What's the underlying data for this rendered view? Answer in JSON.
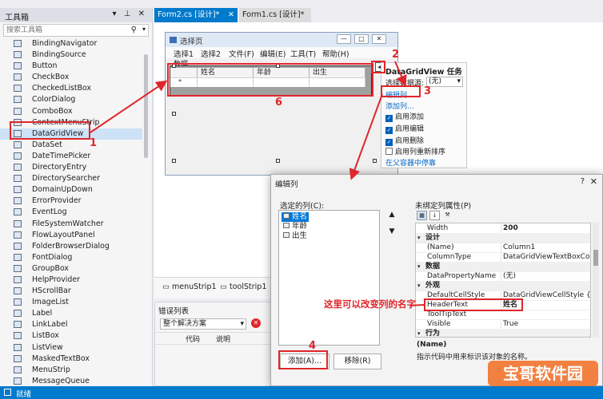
{
  "toolbox": {
    "title": "工具箱",
    "search_placeholder": "搜索工具箱",
    "items": [
      "BindingNavigator",
      "BindingSource",
      "Button",
      "CheckBox",
      "CheckedListBox",
      "ColorDialog",
      "ComboBox",
      "ContextMenuStrip",
      "DataGridView",
      "DataSet",
      "DateTimePicker",
      "DirectoryEntry",
      "DirectorySearcher",
      "DomainUpDown",
      "ErrorProvider",
      "EventLog",
      "FileSystemWatcher",
      "FlowLayoutPanel",
      "FolderBrowserDialog",
      "FontDialog",
      "GroupBox",
      "HelpProvider",
      "HScrollBar",
      "ImageList",
      "Label",
      "LinkLabel",
      "ListBox",
      "ListView",
      "MaskedTextBox",
      "MenuStrip",
      "MessageQueue"
    ],
    "selected": "DataGridView"
  },
  "tabs": [
    {
      "label": "Form2.cs [设计]*",
      "active": true
    },
    {
      "label": "Form1.cs [设计]*",
      "active": false
    }
  ],
  "form": {
    "title": "选择页",
    "menu": [
      "选择1",
      "选择2",
      "文件(F)",
      "编辑(E)",
      "工具(T)",
      "帮助(H)"
    ],
    "data_label": "数据",
    "grid_columns": [
      "姓名",
      "年龄",
      "出生"
    ],
    "new_row_marker": "*"
  },
  "tasks": {
    "title": "DataGridView 任务",
    "datasource_label": "选择数据源:",
    "datasource_value": "(无)",
    "edit_columns": "编辑列...",
    "add_column": "添加列...",
    "options": [
      {
        "label": "启用添加",
        "checked": true
      },
      {
        "label": "启用编辑",
        "checked": true
      },
      {
        "label": "启用删除",
        "checked": true
      },
      {
        "label": "启用列重新排序",
        "checked": false
      }
    ],
    "dock": "在父容器中停靠"
  },
  "strip": [
    "menuStrip1",
    "toolStrip1"
  ],
  "errors": {
    "title": "错误列表",
    "scope": "整个解决方案",
    "columns": [
      "代码",
      "说明"
    ]
  },
  "dialog": {
    "title": "编辑列",
    "selected_label": "选定的列(C):",
    "columns": [
      "姓名",
      "年龄",
      "出生"
    ],
    "selected_column": "姓名",
    "up": "▲",
    "down": "▼",
    "add_button": "添加(A)...",
    "remove_button": "移除(R)",
    "props_label": "未绑定列属性(P)",
    "properties": [
      {
        "key": "Width",
        "value": "200",
        "bold": true
      },
      {
        "key": "设计",
        "category": true
      },
      {
        "key": "(Name)",
        "value": "Column1"
      },
      {
        "key": "ColumnType",
        "value": "DataGridViewTextBoxColu"
      },
      {
        "key": "数据",
        "category": true
      },
      {
        "key": "DataPropertyName",
        "value": "(无)"
      },
      {
        "key": "外观",
        "category": true
      },
      {
        "key": "DefaultCellStyle",
        "value": "DataGridViewCellStyle { }"
      },
      {
        "key": "HeaderText",
        "value": "姓名",
        "bold": true
      },
      {
        "key": "ToolTipText",
        "value": ""
      },
      {
        "key": "Visible",
        "value": "True"
      },
      {
        "key": "行为",
        "category": true
      }
    ],
    "desc_title": "(Name)",
    "desc_text": "指示代码中用来标识该对象的名称。"
  },
  "annotations": {
    "n1": "1",
    "n2": "2",
    "n3": "3",
    "n4": "4",
    "n6": "6",
    "note": "这里可以改变列的名字",
    "color": "#e0262b"
  },
  "status": "就绪",
  "watermark": "宝哥软件园",
  "colors": {
    "accent": "#007acc",
    "selection": "#0078d7"
  }
}
